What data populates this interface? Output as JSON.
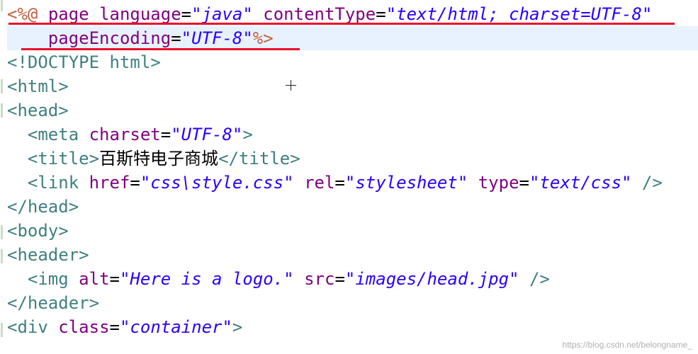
{
  "code": {
    "lines": [
      {
        "tokens": [
          {
            "t": "jsp",
            "v": "<%@"
          },
          {
            "t": "text",
            "v": " "
          },
          {
            "t": "attr",
            "v": "page"
          },
          {
            "t": "text",
            "v": " "
          },
          {
            "t": "attr",
            "v": "language"
          },
          {
            "t": "text",
            "v": "="
          },
          {
            "t": "val",
            "v": "\"java\""
          },
          {
            "t": "text",
            "v": " "
          },
          {
            "t": "attr",
            "v": "contentType"
          },
          {
            "t": "text",
            "v": "="
          },
          {
            "t": "val",
            "v": "\"text/html; charset=UTF-8\""
          }
        ]
      },
      {
        "current": true,
        "tokens": [
          {
            "t": "text",
            "v": "    "
          },
          {
            "t": "attr",
            "v": "pageEncoding"
          },
          {
            "t": "text",
            "v": "="
          },
          {
            "t": "val",
            "v": "\"UTF-8\""
          },
          {
            "t": "jsp",
            "v": "%>"
          }
        ]
      },
      {
        "tokens": [
          {
            "t": "punct",
            "v": "<!"
          },
          {
            "t": "tag",
            "v": "DOCTYPE"
          },
          {
            "t": "text",
            "v": " "
          },
          {
            "t": "tag",
            "v": "html"
          },
          {
            "t": "punct",
            "v": ">"
          }
        ]
      },
      {
        "tokens": [
          {
            "t": "punct",
            "v": "<"
          },
          {
            "t": "tag",
            "v": "html"
          },
          {
            "t": "punct",
            "v": ">"
          }
        ]
      },
      {
        "tokens": [
          {
            "t": "punct",
            "v": "<"
          },
          {
            "t": "tag",
            "v": "head"
          },
          {
            "t": "punct",
            "v": ">"
          }
        ]
      },
      {
        "tokens": [
          {
            "t": "text",
            "v": "  "
          },
          {
            "t": "punct",
            "v": "<"
          },
          {
            "t": "tag",
            "v": "meta"
          },
          {
            "t": "text",
            "v": " "
          },
          {
            "t": "attr",
            "v": "charset"
          },
          {
            "t": "text",
            "v": "="
          },
          {
            "t": "val",
            "v": "\"UTF-8\""
          },
          {
            "t": "punct",
            "v": ">"
          }
        ]
      },
      {
        "tokens": [
          {
            "t": "text",
            "v": "  "
          },
          {
            "t": "punct",
            "v": "<"
          },
          {
            "t": "tag",
            "v": "title"
          },
          {
            "t": "punct",
            "v": ">"
          },
          {
            "t": "text",
            "v": "百斯特电子商城"
          },
          {
            "t": "punct",
            "v": "</"
          },
          {
            "t": "tag",
            "v": "title"
          },
          {
            "t": "punct",
            "v": ">"
          }
        ]
      },
      {
        "tokens": [
          {
            "t": "text",
            "v": "  "
          },
          {
            "t": "punct",
            "v": "<"
          },
          {
            "t": "tag",
            "v": "link"
          },
          {
            "t": "text",
            "v": " "
          },
          {
            "t": "attr",
            "v": "href"
          },
          {
            "t": "text",
            "v": "="
          },
          {
            "t": "val",
            "v": "\"css\\style.css\""
          },
          {
            "t": "text",
            "v": " "
          },
          {
            "t": "attr",
            "v": "rel"
          },
          {
            "t": "text",
            "v": "="
          },
          {
            "t": "val",
            "v": "\"stylesheet\""
          },
          {
            "t": "text",
            "v": " "
          },
          {
            "t": "attr",
            "v": "type"
          },
          {
            "t": "text",
            "v": "="
          },
          {
            "t": "val",
            "v": "\"text/css\""
          },
          {
            "t": "text",
            "v": " "
          },
          {
            "t": "punct",
            "v": "/>"
          }
        ]
      },
      {
        "tokens": [
          {
            "t": "punct",
            "v": "</"
          },
          {
            "t": "tag",
            "v": "head"
          },
          {
            "t": "punct",
            "v": ">"
          }
        ]
      },
      {
        "tokens": [
          {
            "t": "punct",
            "v": "<"
          },
          {
            "t": "tag",
            "v": "body"
          },
          {
            "t": "punct",
            "v": ">"
          }
        ]
      },
      {
        "tokens": [
          {
            "t": "punct",
            "v": "<"
          },
          {
            "t": "tag",
            "v": "header"
          },
          {
            "t": "punct",
            "v": ">"
          }
        ]
      },
      {
        "tokens": [
          {
            "t": "text",
            "v": "  "
          },
          {
            "t": "punct",
            "v": "<"
          },
          {
            "t": "tag",
            "v": "img"
          },
          {
            "t": "text",
            "v": " "
          },
          {
            "t": "attr",
            "v": "alt"
          },
          {
            "t": "text",
            "v": "="
          },
          {
            "t": "val",
            "v": "\"Here is a logo.\""
          },
          {
            "t": "text",
            "v": " "
          },
          {
            "t": "attr",
            "v": "src"
          },
          {
            "t": "text",
            "v": "="
          },
          {
            "t": "val",
            "v": "\"images/head.jpg\""
          },
          {
            "t": "text",
            "v": " "
          },
          {
            "t": "punct",
            "v": "/>"
          }
        ]
      },
      {
        "tokens": [
          {
            "t": "punct",
            "v": "</"
          },
          {
            "t": "tag",
            "v": "header"
          },
          {
            "t": "punct",
            "v": ">"
          }
        ]
      },
      {
        "tokens": [
          {
            "t": "punct",
            "v": "<"
          },
          {
            "t": "tag",
            "v": "div"
          },
          {
            "t": "text",
            "v": " "
          },
          {
            "t": "attr",
            "v": "class"
          },
          {
            "t": "text",
            "v": "="
          },
          {
            "t": "val",
            "v": "\"container\""
          },
          {
            "t": "punct",
            "v": ">"
          }
        ]
      }
    ]
  },
  "annotation_color": "#e8102a",
  "watermark": "https://blog.csdn.net/belongname_"
}
